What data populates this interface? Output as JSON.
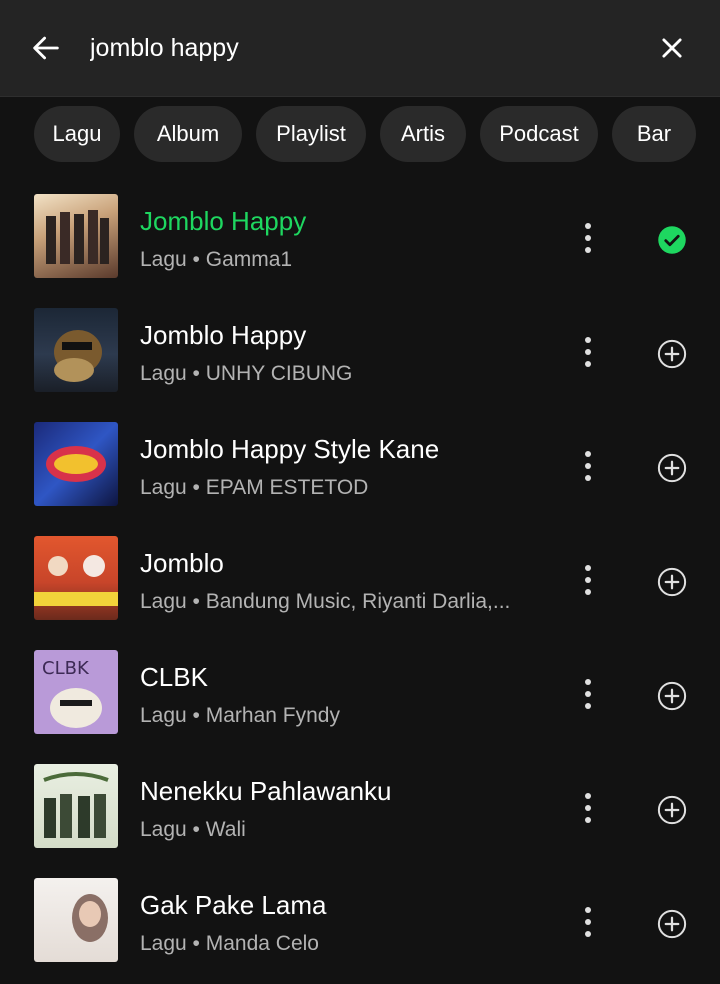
{
  "search": {
    "query": "jomblo happy",
    "back_icon": "arrow-left-icon",
    "clear_icon": "close-icon"
  },
  "filters": [
    "Lagu",
    "Album",
    "Playlist",
    "Artis",
    "Podcast",
    "Bar"
  ],
  "colors": {
    "accent": "#1ed760",
    "background": "#121212",
    "chip": "#2a2a2a",
    "secondary_text": "#b3b3b3"
  },
  "results": [
    {
      "title": "Jomblo Happy",
      "subtitle": "Lagu • Gamma1",
      "playing": true,
      "action_icon": "check-circle-icon"
    },
    {
      "title": "Jomblo Happy",
      "subtitle": "Lagu • UNHY CIBUNG",
      "playing": false,
      "action_icon": "add-circle-icon"
    },
    {
      "title": "Jomblo Happy Style Kane",
      "subtitle": "Lagu • EPAM ESTETOD",
      "playing": false,
      "action_icon": "add-circle-icon"
    },
    {
      "title": "Jomblo",
      "subtitle": "Lagu • Bandung Music, Riyanti Darlia,...",
      "playing": false,
      "action_icon": "add-circle-icon"
    },
    {
      "title": "CLBK",
      "subtitle": "Lagu • Marhan Fyndy",
      "playing": false,
      "action_icon": "add-circle-icon"
    },
    {
      "title": "Nenekku Pahlawanku",
      "subtitle": "Lagu • Wali",
      "playing": false,
      "action_icon": "add-circle-icon"
    },
    {
      "title": "Gak Pake Lama",
      "subtitle": "Lagu • Manda Celo",
      "playing": false,
      "action_icon": "add-circle-icon"
    }
  ]
}
